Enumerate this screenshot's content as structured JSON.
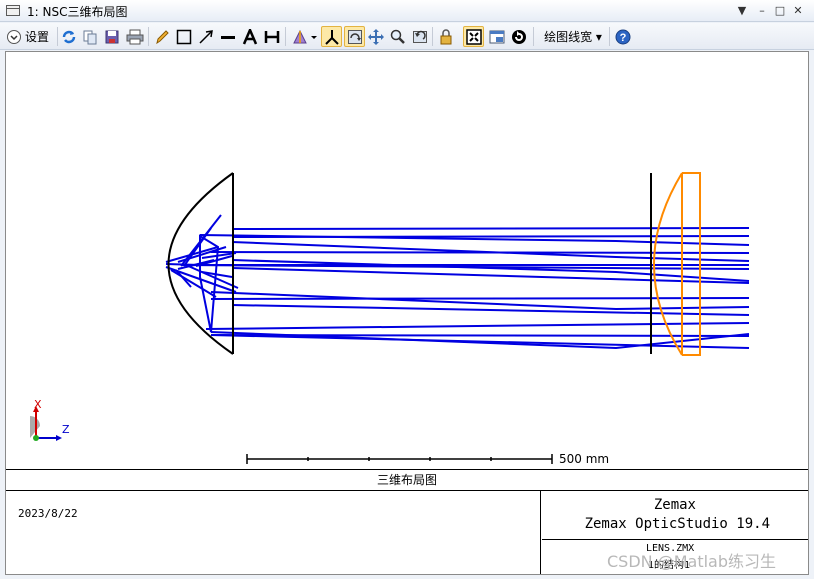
{
  "window": {
    "title": "1: NSC三维布局图",
    "controls": [
      "▼",
      "–",
      "□",
      "✕"
    ]
  },
  "toolbar": {
    "settings_label": "设置",
    "line_width_label": "绘图线宽 ▾",
    "icons": [
      "refresh-icon",
      "copy-icon",
      "save-icon",
      "print-icon",
      "pencil-icon",
      "rectangle-icon",
      "arrow-icon",
      "line-icon",
      "text-icon",
      "dimension-icon",
      "rotate-icon",
      "axes-icon",
      "lock-rotation-icon",
      "pan-icon",
      "zoom-icon",
      "undo-zoom-icon",
      "lock-icon",
      "fit-icon",
      "window-icon",
      "reset-icon",
      "help-icon"
    ],
    "active_color": "#fde9a7"
  },
  "plot": {
    "scale_label": "500 mm",
    "axis_x_label": "X",
    "axis_z_label": "Z",
    "ray_color": "#0000e0",
    "lens_color": "#ff8a00",
    "mirror_color": "#000000"
  },
  "footer": {
    "title": "三维布局图",
    "date": "2023/8/22",
    "company": "Zemax",
    "product": "Zemax OpticStudio 19.4",
    "lens_file": "LENS.ZMX",
    "configuration": "1的结构1"
  },
  "watermark": "CSDN @Matlab练习生"
}
